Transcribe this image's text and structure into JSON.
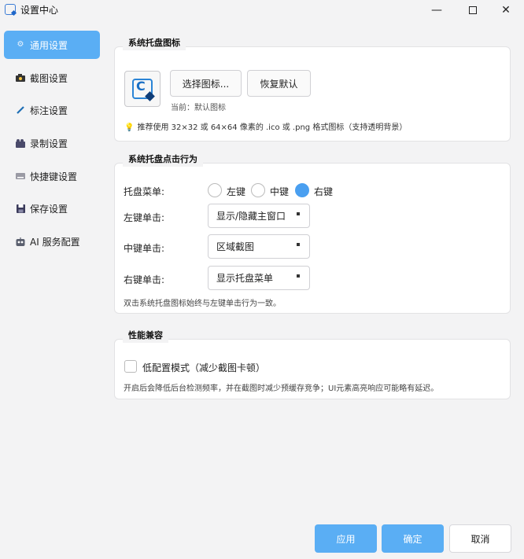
{
  "window": {
    "title": "设置中心",
    "minimize": "—",
    "close": "✕"
  },
  "sidebar": {
    "items": [
      {
        "label": "通用设置",
        "icon": "gear-icon",
        "active": true
      },
      {
        "label": "截图设置",
        "icon": "camera-icon"
      },
      {
        "label": "标注设置",
        "icon": "pen-icon"
      },
      {
        "label": "录制设置",
        "icon": "video-icon"
      },
      {
        "label": "快捷键设置",
        "icon": "keyboard-icon"
      },
      {
        "label": "保存设置",
        "icon": "save-icon"
      },
      {
        "label": "AI 服务配置",
        "icon": "robot-icon"
      }
    ]
  },
  "tray_icon": {
    "title": "系统托盘图标",
    "choose_label": "选择图标...",
    "reset_label": "恢复默认",
    "current_text": "当前：默认图标",
    "hint": "推荐使用 32×32 或 64×64 像素的 .ico 或 .png 格式图标（支持透明背景）"
  },
  "tray_click": {
    "title": "系统托盘点击行为",
    "menu_label": "托盘菜单:",
    "options": [
      "左键",
      "中键",
      "右键"
    ],
    "selected": "右键",
    "left_click_label": "左键单击:",
    "left_click_value": "显示/隐藏主窗口",
    "middle_click_label": "中键单击:",
    "middle_click_value": "区域截图",
    "right_click_label": "右键单击:",
    "right_click_value": "显示托盘菜单",
    "note": "双击系统托盘图标始终与左键单击行为一致。"
  },
  "performance": {
    "title": "性能兼容",
    "low_config_label": "低配置模式（减少截图卡顿）",
    "low_config_checked": false,
    "note": "开启后会降低后台检测频率，并在截图时减少预缓存竞争；UI元素高亮响应可能略有延迟。"
  },
  "footer": {
    "apply": "应用",
    "ok": "确定",
    "cancel": "取消"
  },
  "colors": {
    "accent": "#5aaef4",
    "radio_checked": "#4a9ff0",
    "bulb": "#f2b705"
  }
}
